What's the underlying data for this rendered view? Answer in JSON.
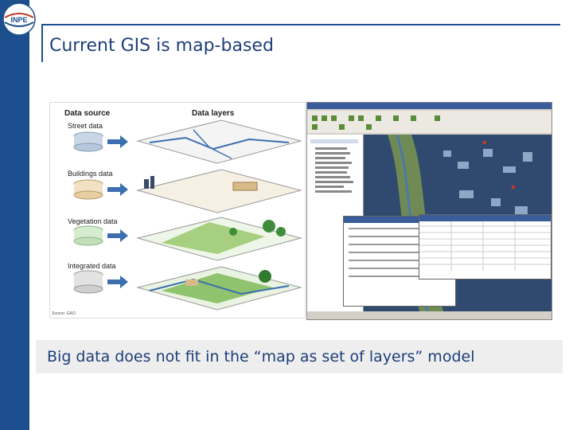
{
  "slide": {
    "title": "Current GIS is map-based",
    "caption": "Big data does not fit in the “map as set of layers” model"
  },
  "logo": {
    "text": "INPE"
  },
  "figure": {
    "data_source_heading": "Data source",
    "data_layers_heading": "Data layers",
    "rows": [
      {
        "label": "Street data"
      },
      {
        "label": "Buildings data"
      },
      {
        "label": "Vegetation data"
      },
      {
        "label": "Integrated data"
      }
    ],
    "source_note": "Source: GAO."
  },
  "colors": {
    "sidebar": "#1d4f8f",
    "title": "#1d3f7a",
    "caption_bg": "#eeeeee"
  }
}
